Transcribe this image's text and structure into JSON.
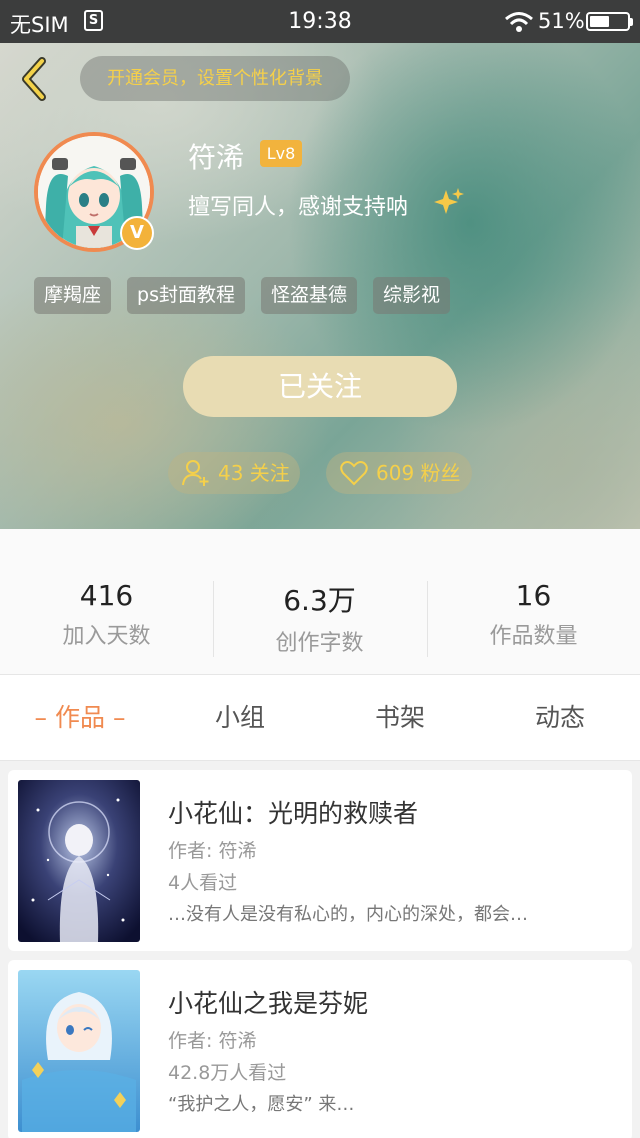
{
  "status_bar": {
    "carrier": "无SIM",
    "sim_badge": "S",
    "time": "19:38",
    "battery_percent": "51%"
  },
  "header": {
    "vip_banner": "开通会员，设置个性化背景",
    "username": "符浠",
    "level": "Lv8",
    "verified_badge": "V",
    "bio": "擅写同人，感谢支持呐",
    "tags": [
      "摩羯座",
      "ps封面教程",
      "怪盗基德",
      "综影视"
    ],
    "follow_button": "已关注",
    "following_text": "43 关注",
    "fans_text": "609 粉丝"
  },
  "stats": [
    {
      "value": "416",
      "label": "加入天数"
    },
    {
      "value": "6.3万",
      "label": "创作字数"
    },
    {
      "value": "16",
      "label": "作品数量"
    }
  ],
  "tabs": {
    "works": "– 作品 –",
    "groups": "小组",
    "bookshelf": "书架",
    "activity": "动态"
  },
  "works": [
    {
      "title": "小花仙：光明的救赎者",
      "author": "作者: 符浠",
      "views": "4人看过",
      "desc": "…没有人是没有私心的，内心的深处，都会…"
    },
    {
      "title": "小花仙之我是芬妮",
      "author": "作者: 符浠",
      "views": "42.8万人看过",
      "desc": "“我护之人，愿安” 来…"
    }
  ],
  "colors": {
    "accent_orange": "#f08a50",
    "gold_text": "#f5d04a",
    "level_badge": "#f2b33d",
    "follow_button": "#e8dcb3"
  },
  "icons": [
    "back-arrow-icon",
    "wifi-icon",
    "battery-icon",
    "sparkle-icon",
    "add-user-icon",
    "heart-icon",
    "verified-v-icon"
  ]
}
